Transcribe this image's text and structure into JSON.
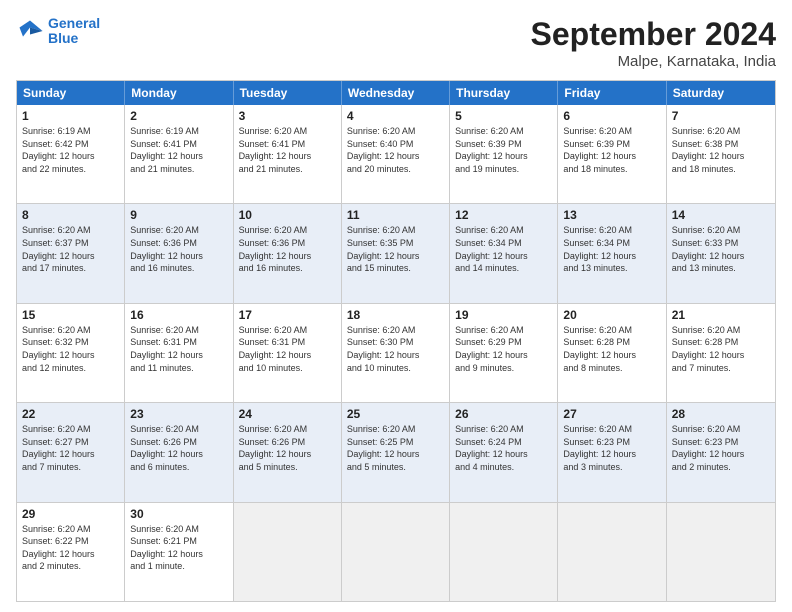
{
  "logo": {
    "line1": "General",
    "line2": "Blue"
  },
  "title": "September 2024",
  "location": "Malpe, Karnataka, India",
  "days": [
    "Sunday",
    "Monday",
    "Tuesday",
    "Wednesday",
    "Thursday",
    "Friday",
    "Saturday"
  ],
  "rows": [
    [
      {
        "day": "",
        "text": ""
      },
      {
        "day": "2",
        "text": "Sunrise: 6:19 AM\nSunset: 6:41 PM\nDaylight: 12 hours\nand 21 minutes."
      },
      {
        "day": "3",
        "text": "Sunrise: 6:20 AM\nSunset: 6:41 PM\nDaylight: 12 hours\nand 21 minutes."
      },
      {
        "day": "4",
        "text": "Sunrise: 6:20 AM\nSunset: 6:40 PM\nDaylight: 12 hours\nand 20 minutes."
      },
      {
        "day": "5",
        "text": "Sunrise: 6:20 AM\nSunset: 6:39 PM\nDaylight: 12 hours\nand 19 minutes."
      },
      {
        "day": "6",
        "text": "Sunrise: 6:20 AM\nSunset: 6:39 PM\nDaylight: 12 hours\nand 18 minutes."
      },
      {
        "day": "7",
        "text": "Sunrise: 6:20 AM\nSunset: 6:38 PM\nDaylight: 12 hours\nand 18 minutes."
      }
    ],
    [
      {
        "day": "8",
        "text": "Sunrise: 6:20 AM\nSunset: 6:37 PM\nDaylight: 12 hours\nand 17 minutes."
      },
      {
        "day": "9",
        "text": "Sunrise: 6:20 AM\nSunset: 6:36 PM\nDaylight: 12 hours\nand 16 minutes."
      },
      {
        "day": "10",
        "text": "Sunrise: 6:20 AM\nSunset: 6:36 PM\nDaylight: 12 hours\nand 16 minutes."
      },
      {
        "day": "11",
        "text": "Sunrise: 6:20 AM\nSunset: 6:35 PM\nDaylight: 12 hours\nand 15 minutes."
      },
      {
        "day": "12",
        "text": "Sunrise: 6:20 AM\nSunset: 6:34 PM\nDaylight: 12 hours\nand 14 minutes."
      },
      {
        "day": "13",
        "text": "Sunrise: 6:20 AM\nSunset: 6:34 PM\nDaylight: 12 hours\nand 13 minutes."
      },
      {
        "day": "14",
        "text": "Sunrise: 6:20 AM\nSunset: 6:33 PM\nDaylight: 12 hours\nand 13 minutes."
      }
    ],
    [
      {
        "day": "15",
        "text": "Sunrise: 6:20 AM\nSunset: 6:32 PM\nDaylight: 12 hours\nand 12 minutes."
      },
      {
        "day": "16",
        "text": "Sunrise: 6:20 AM\nSunset: 6:31 PM\nDaylight: 12 hours\nand 11 minutes."
      },
      {
        "day": "17",
        "text": "Sunrise: 6:20 AM\nSunset: 6:31 PM\nDaylight: 12 hours\nand 10 minutes."
      },
      {
        "day": "18",
        "text": "Sunrise: 6:20 AM\nSunset: 6:30 PM\nDaylight: 12 hours\nand 10 minutes."
      },
      {
        "day": "19",
        "text": "Sunrise: 6:20 AM\nSunset: 6:29 PM\nDaylight: 12 hours\nand 9 minutes."
      },
      {
        "day": "20",
        "text": "Sunrise: 6:20 AM\nSunset: 6:28 PM\nDaylight: 12 hours\nand 8 minutes."
      },
      {
        "day": "21",
        "text": "Sunrise: 6:20 AM\nSunset: 6:28 PM\nDaylight: 12 hours\nand 7 minutes."
      }
    ],
    [
      {
        "day": "22",
        "text": "Sunrise: 6:20 AM\nSunset: 6:27 PM\nDaylight: 12 hours\nand 7 minutes."
      },
      {
        "day": "23",
        "text": "Sunrise: 6:20 AM\nSunset: 6:26 PM\nDaylight: 12 hours\nand 6 minutes."
      },
      {
        "day": "24",
        "text": "Sunrise: 6:20 AM\nSunset: 6:26 PM\nDaylight: 12 hours\nand 5 minutes."
      },
      {
        "day": "25",
        "text": "Sunrise: 6:20 AM\nSunset: 6:25 PM\nDaylight: 12 hours\nand 5 minutes."
      },
      {
        "day": "26",
        "text": "Sunrise: 6:20 AM\nSunset: 6:24 PM\nDaylight: 12 hours\nand 4 minutes."
      },
      {
        "day": "27",
        "text": "Sunrise: 6:20 AM\nSunset: 6:23 PM\nDaylight: 12 hours\nand 3 minutes."
      },
      {
        "day": "28",
        "text": "Sunrise: 6:20 AM\nSunset: 6:23 PM\nDaylight: 12 hours\nand 2 minutes."
      }
    ],
    [
      {
        "day": "29",
        "text": "Sunrise: 6:20 AM\nSunset: 6:22 PM\nDaylight: 12 hours\nand 2 minutes."
      },
      {
        "day": "30",
        "text": "Sunrise: 6:20 AM\nSunset: 6:21 PM\nDaylight: 12 hours\nand 1 minute."
      },
      {
        "day": "",
        "text": ""
      },
      {
        "day": "",
        "text": ""
      },
      {
        "day": "",
        "text": ""
      },
      {
        "day": "",
        "text": ""
      },
      {
        "day": "",
        "text": ""
      }
    ]
  ],
  "row0_day1": {
    "day": "1",
    "text": "Sunrise: 6:19 AM\nSunset: 6:42 PM\nDaylight: 12 hours\nand 22 minutes."
  }
}
